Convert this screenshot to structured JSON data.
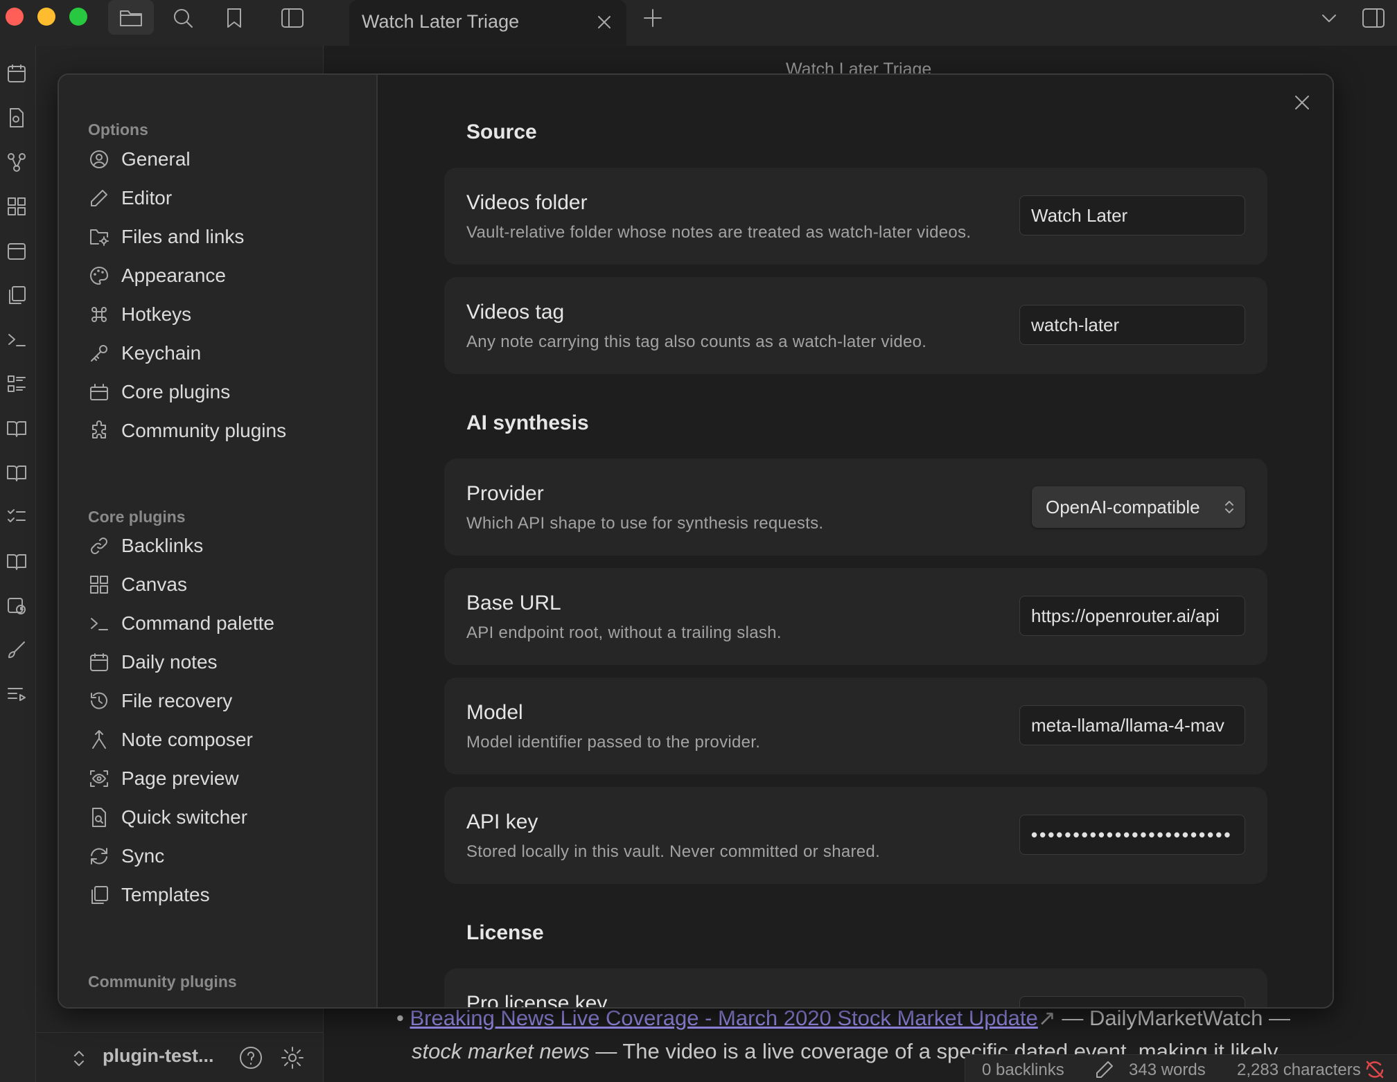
{
  "window": {
    "tab_title": "Watch Later Triage",
    "note_title": "Watch Later Triage"
  },
  "colors": {
    "accent": "#9b8ff0",
    "traffic_red": "#ff5f57",
    "traffic_yellow": "#febc2e",
    "traffic_green": "#28c840"
  },
  "vault": {
    "name": "plugin-test..."
  },
  "settings": {
    "options_heading": "Options",
    "options": [
      {
        "label": "General",
        "icon": "user-circle-icon"
      },
      {
        "label": "Editor",
        "icon": "pencil-icon"
      },
      {
        "label": "Files and links",
        "icon": "folder-cog-icon"
      },
      {
        "label": "Appearance",
        "icon": "palette-icon"
      },
      {
        "label": "Hotkeys",
        "icon": "command-icon"
      },
      {
        "label": "Keychain",
        "icon": "key-icon"
      },
      {
        "label": "Core plugins",
        "icon": "plugin-box-icon"
      },
      {
        "label": "Community plugins",
        "icon": "puzzle-icon"
      }
    ],
    "core_heading": "Core plugins",
    "core": [
      {
        "label": "Backlinks",
        "icon": "link-icon"
      },
      {
        "label": "Canvas",
        "icon": "grid-icon"
      },
      {
        "label": "Command palette",
        "icon": "terminal-icon"
      },
      {
        "label": "Daily notes",
        "icon": "calendar-icon"
      },
      {
        "label": "File recovery",
        "icon": "history-icon"
      },
      {
        "label": "Note composer",
        "icon": "merge-icon"
      },
      {
        "label": "Page preview",
        "icon": "eye-scan-icon"
      },
      {
        "label": "Quick switcher",
        "icon": "file-search-icon"
      },
      {
        "label": "Sync",
        "icon": "sync-icon"
      },
      {
        "label": "Templates",
        "icon": "copy-icon"
      }
    ],
    "community_heading": "Community plugins",
    "sections": {
      "source": "Source",
      "ai": "AI synthesis",
      "license": "License"
    },
    "fields": {
      "videos_folder": {
        "name": "Videos folder",
        "desc": "Vault-relative folder whose notes are treated as watch-later videos.",
        "value": "Watch Later"
      },
      "videos_tag": {
        "name": "Videos tag",
        "desc": "Any note carrying this tag also counts as a watch-later video.",
        "value": "watch-later"
      },
      "provider": {
        "name": "Provider",
        "desc": "Which API shape to use for synthesis requests.",
        "value": "OpenAI-compatible"
      },
      "base_url": {
        "name": "Base URL",
        "desc": "API endpoint root, without a trailing slash.",
        "value": "https://openrouter.ai/api"
      },
      "model": {
        "name": "Model",
        "desc": "Model identifier passed to the provider.",
        "value": "meta-llama/llama-4-mav"
      },
      "api_key": {
        "name": "API key",
        "desc": "Stored locally in this vault. Never committed or shared.",
        "value": "••••••••••••••••••••••••"
      },
      "pro_license": {
        "name": "Pro license key"
      }
    }
  },
  "note": {
    "link_text": "Breaking News Live Coverage - March 2020 Stock Market Update",
    "after_link": " — DailyMarketWatch —",
    "italic": "stock market news",
    "rest": " — The video is a live coverage of a specific dated event, making it likely"
  },
  "status": {
    "backlinks": "0 backlinks",
    "words": "343 words",
    "chars": "2,283 characters"
  }
}
